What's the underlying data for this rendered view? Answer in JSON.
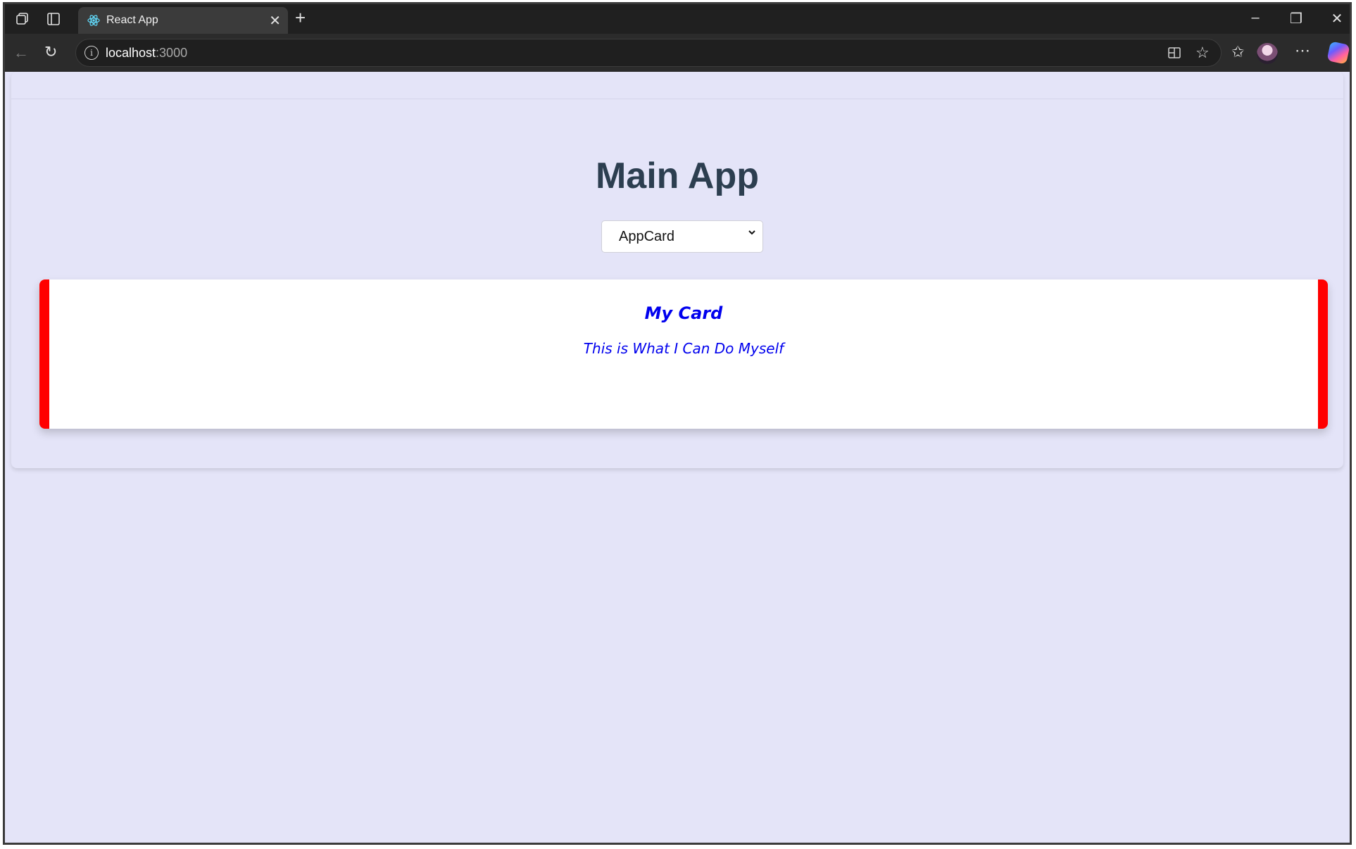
{
  "browser": {
    "tab_title": "React App",
    "new_tab_symbol": "+",
    "address": {
      "host": "localhost",
      "port": ":3000"
    },
    "icons": [
      "workspaces-icon",
      "tab-actions-icon",
      "react-favicon-icon",
      "close-tab-icon",
      "new-tab-icon",
      "minimize-icon",
      "restore-icon",
      "close-window-icon",
      "back-icon",
      "refresh-icon",
      "site-info-icon",
      "split-screen-icon",
      "favorite-star-icon",
      "favorites-icon",
      "profile-avatar",
      "more-icon",
      "copilot-icon"
    ]
  },
  "app": {
    "title": "Main App",
    "select": {
      "value": "AppCard"
    },
    "card": {
      "title": "My Card",
      "text": "This is What I Can Do Myself",
      "accent_color": "#ff0000",
      "text_color": "#0000ee"
    },
    "background_color": "#e4e4f8",
    "title_color": "#2c3e50"
  }
}
